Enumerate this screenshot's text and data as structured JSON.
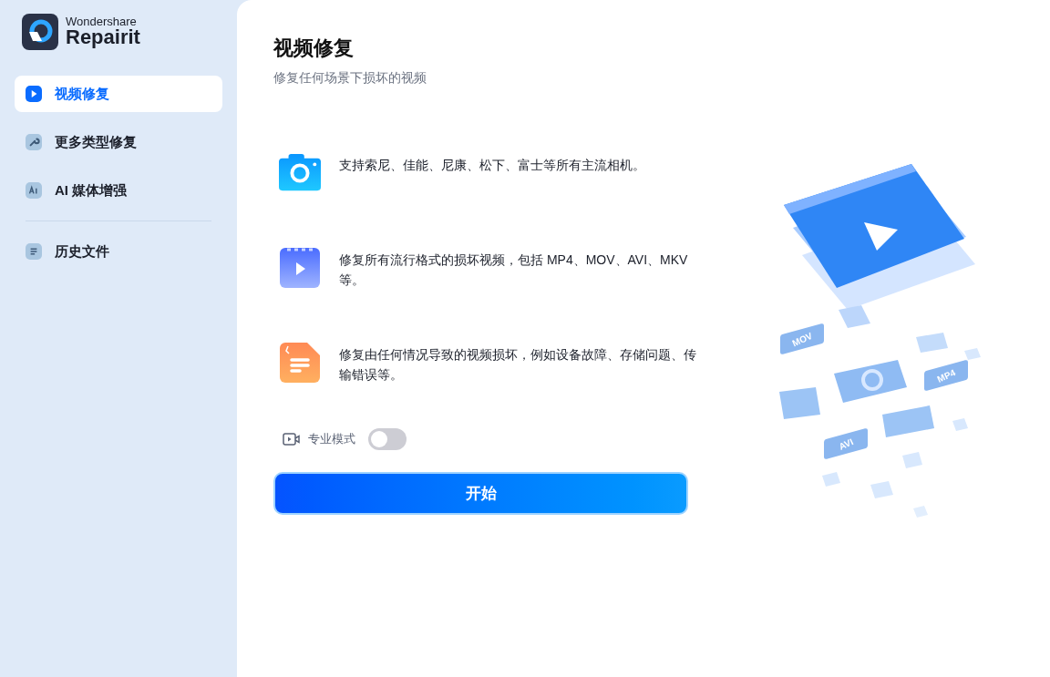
{
  "brand": {
    "company": "Wondershare",
    "product": "Repairit"
  },
  "sidebar": {
    "items": [
      {
        "kind": "video",
        "label": "视频修复",
        "selected": true
      },
      {
        "kind": "wrench",
        "label": "更多类型修复",
        "selected": false
      },
      {
        "kind": "ai",
        "label": "AI 媒体增强",
        "selected": false
      }
    ],
    "bottom_items": [
      {
        "kind": "history",
        "label": "历史文件",
        "selected": false
      }
    ]
  },
  "page": {
    "title": "视频修复",
    "subtitle": "修复任何场景下损坏的视频"
  },
  "features": [
    {
      "kind": "camera",
      "text": "支持索尼、佳能、尼康、松下、富士等所有主流相机。"
    },
    {
      "kind": "video",
      "text": "修复所有流行格式的损坏视频，包括 MP4、MOV、AVI、MKV 等。"
    },
    {
      "kind": "file",
      "text": "修复由任何情况导致的视频损坏，例如设备故障、存储问题、传输错误等。"
    }
  ],
  "pro_mode": {
    "label": "专业模式",
    "on": false
  },
  "start_button": "开始",
  "illustration": {
    "file_tags": [
      "MOV",
      "MP4",
      "AVI"
    ]
  }
}
